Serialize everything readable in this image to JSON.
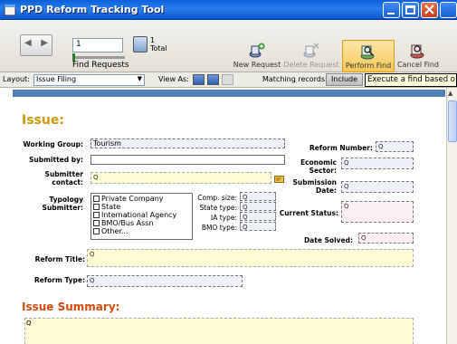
{
  "window": {
    "title": "PPD Reform Tracking Tool"
  },
  "toolbar": {
    "record_number": "1",
    "found_count": "1",
    "found_total_label": "Total",
    "find_requests_label": "Find Requests",
    "new_request_label": "New Request",
    "delete_request_label": "Delete Request",
    "perform_find_label": "Perform Find",
    "cancel_find_label": "Cancel Find"
  },
  "layoutbar": {
    "layout_label": "Layout:",
    "layout_value": "Issue Filing",
    "view_as_label": "View As:",
    "matching_label": "Matching records:",
    "include_label": "Include",
    "tooltip": "Execute a find based o"
  },
  "form": {
    "issue_title": "Issue:",
    "working_group_label": "Working Group:",
    "working_group_value": "Tourism",
    "submitted_by_label": "Submitted by:",
    "submitter_contact_label_1": "Submitter",
    "submitter_contact_label_2": "contact:",
    "typology_label_1": "Typology",
    "typology_label_2": "Submitter:",
    "typology_options": [
      "Private Company",
      "State",
      "International Agency",
      "BMO/Bus Assn",
      "Other..."
    ],
    "comp_size_label": "Comp. size:",
    "state_type_label": "State type:",
    "ia_type_label": "IA type:",
    "bmo_type_label": "BMO type:",
    "reform_number_label": "Reform Number:",
    "economic_sector_label_1": "Economic",
    "economic_sector_label_2": "Sector:",
    "submission_date_label_1": "Submission",
    "submission_date_label_2": "Date:",
    "current_status_label": "Current Status:",
    "date_solved_label": "Date Solved:",
    "reform_title_label": "Reform Title:",
    "reform_type_label": "Reform Type:",
    "issue_summary_title": "Issue Summary:",
    "query_glyph": "Q"
  }
}
